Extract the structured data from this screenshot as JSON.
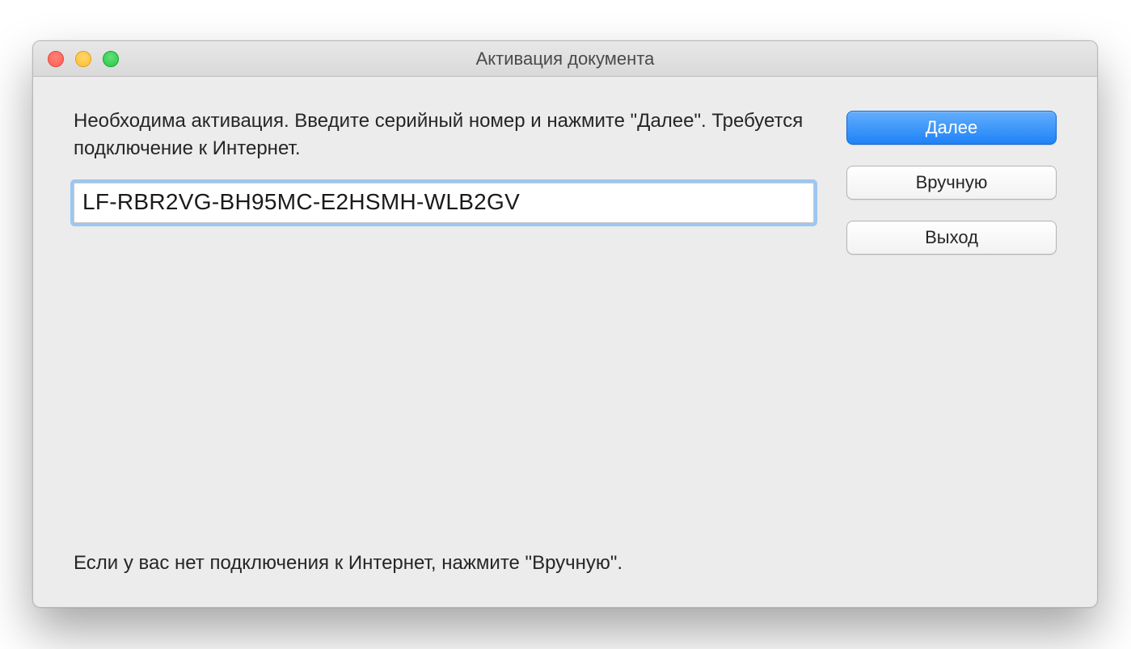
{
  "window": {
    "title": "Активация документа"
  },
  "main": {
    "instructions": "Необходима активация. Введите серийный номер и нажмите \"Далее\". Требуется подключение к Интернет.",
    "serial_value": "LF-RBR2VG-BH95MC-E2HSMH-WLB2GV",
    "footer": "Если у вас нет подключения к Интернет, нажмите \"Вручную\"."
  },
  "buttons": {
    "next": "Далее",
    "manual": "Вручную",
    "exit": "Выход"
  }
}
